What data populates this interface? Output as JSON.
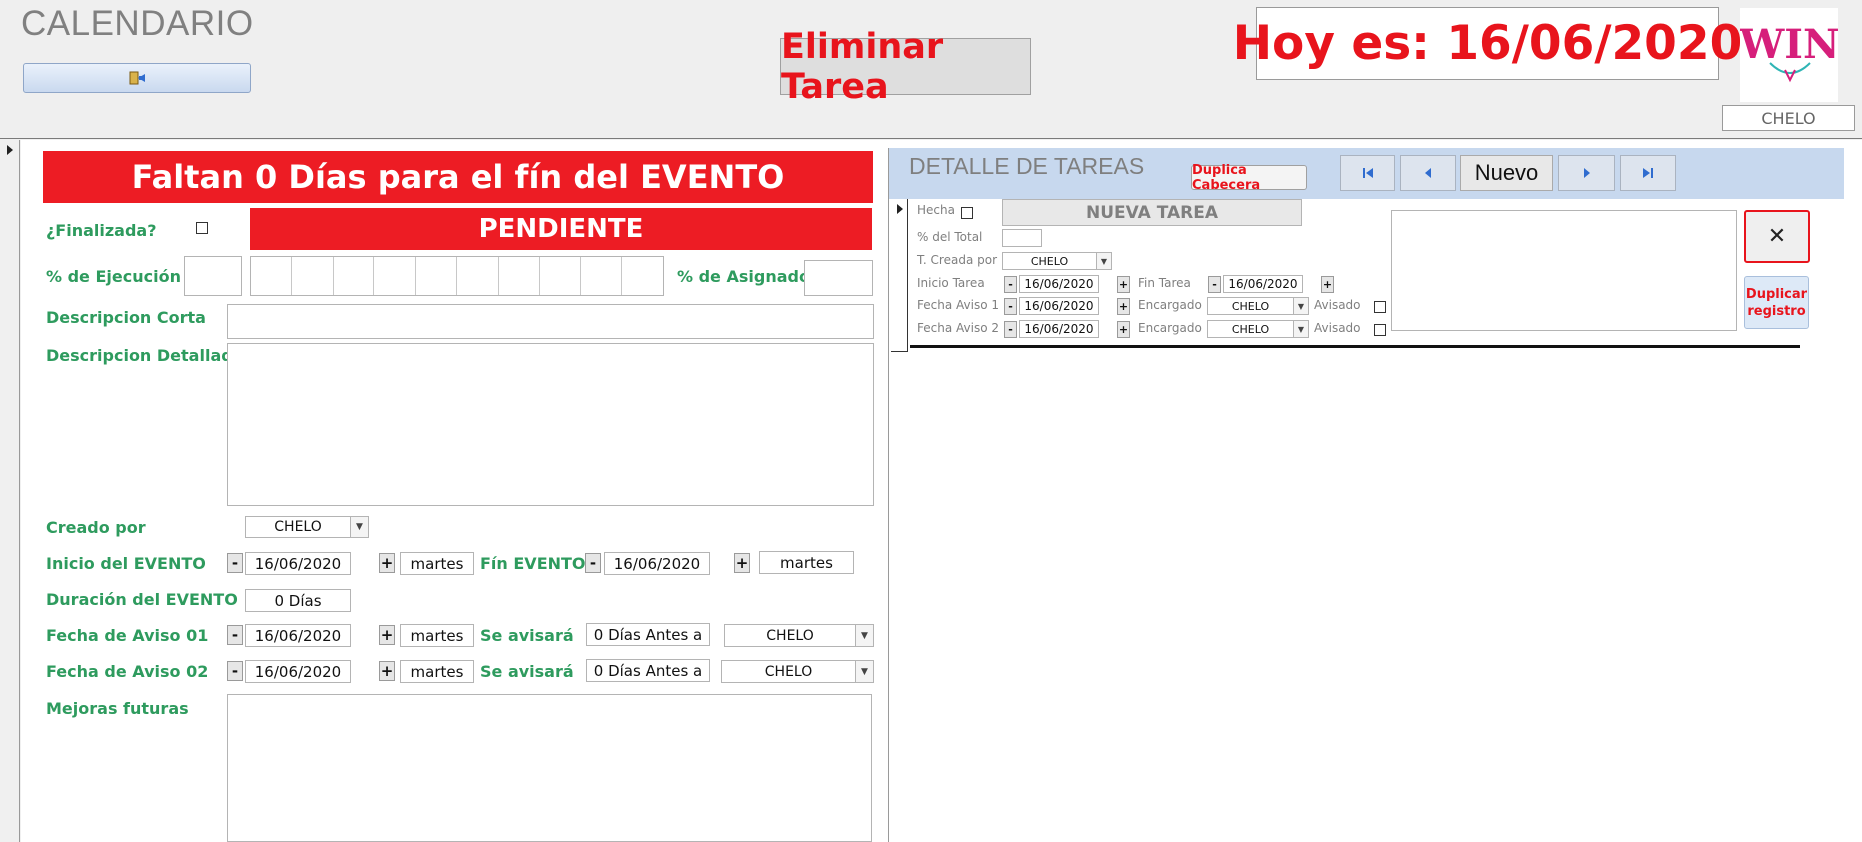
{
  "header": {
    "app_title": "CALENDARIO",
    "exit_icon": "exit-door-icon",
    "delete_task_label": "Eliminar Tarea",
    "today_text": "Hoy es: 16/06/2020",
    "logo_text": "TWINS",
    "current_user": "CHELO"
  },
  "event": {
    "days_left_banner": "Faltan 0 Días para el fín del EVENTO",
    "finalizada_label": "¿Finalizada?",
    "status": "PENDIENTE",
    "ejecucion_label": "% de Ejecución",
    "ejecucion_value": "",
    "asignado_label": "% de Asignado",
    "asignado_value": "",
    "desc_corta_label": "Descripcion Corta",
    "desc_corta_value": "",
    "desc_det_label": "Descripcion Detallada",
    "desc_det_value": "",
    "creado_label": "Creado por",
    "creado_value": "CHELO",
    "inicio_label": "Inicio del EVENTO",
    "inicio_date": "16/06/2020",
    "inicio_day": "martes",
    "fin_label": "Fín EVENTO",
    "fin_date": "16/06/2020",
    "fin_day": "martes",
    "duracion_label": "Duración del EVENTO",
    "duracion_value": "0 Días",
    "aviso1_label": "Fecha de Aviso 01",
    "aviso1_date": "16/06/2020",
    "aviso1_day": "martes",
    "se_avisara_label": "Se avisará",
    "aviso1_antes": "0 Días Antes a",
    "aviso1_user": "CHELO",
    "aviso2_label": "Fecha de Aviso 02",
    "aviso2_date": "16/06/2020",
    "aviso2_day": "martes",
    "aviso2_antes": "0 Días Antes a",
    "aviso2_user": "CHELO",
    "mejoras_label": "Mejoras futuras",
    "mejoras_value": "",
    "minus": "-",
    "plus": "+"
  },
  "detail": {
    "title": "DETALLE DE TAREAS",
    "duplica_cabecera": "Duplica Cabecera",
    "nav_current": "Nuevo",
    "hecha_label": "Hecha",
    "nueva_tarea": "NUEVA TAREA",
    "pct_total_label": "% del Total",
    "pct_total_value": "",
    "creada_por_label": "T. Creada por",
    "creada_por_value": "CHELO",
    "inicio_label": "Inicio Tarea",
    "inicio_date": "16/06/2020",
    "fin_label": "Fin Tarea",
    "fin_date": "16/06/2020",
    "aviso1_label": "Fecha Aviso 1",
    "aviso1_date": "16/06/2020",
    "aviso2_label": "Fecha Aviso 2",
    "aviso2_date": "16/06/2020",
    "encargado_label": "Encargado",
    "encargado1": "CHELO",
    "encargado2": "CHELO",
    "avisado_label": "Avisado",
    "notes_value": "",
    "close_symbol": "✕",
    "duplicar_registro": "Duplicar registro"
  },
  "colors": {
    "accent_red": "#ed1c24",
    "label_green": "#2e9b5e",
    "header_blue": "#c7d8ee"
  }
}
